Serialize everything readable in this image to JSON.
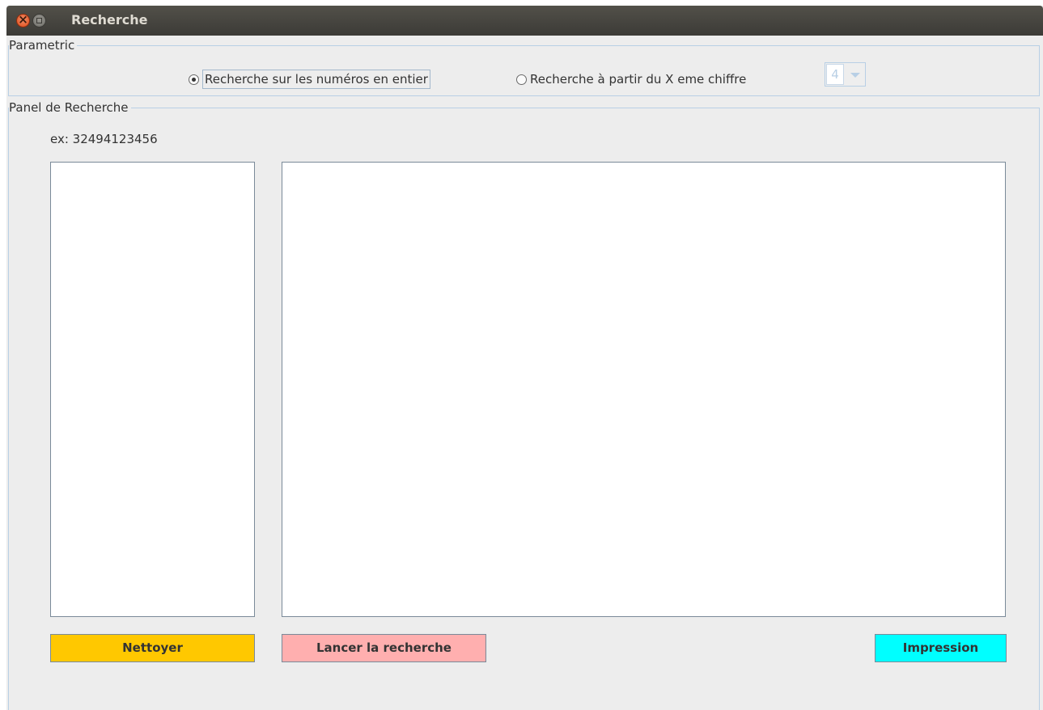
{
  "window": {
    "title": "Recherche"
  },
  "parametric": {
    "legend": "Parametric",
    "options": [
      {
        "label": "Recherche sur les numéros en entier",
        "checked": true
      },
      {
        "label": "Recherche à partir du X eme chiffre",
        "checked": false
      }
    ],
    "digit_select": {
      "value": "4",
      "enabled": false
    }
  },
  "search_panel": {
    "legend": "Panel de Recherche",
    "example": "ex: 32494123456",
    "input_text": "",
    "results_text": ""
  },
  "buttons": {
    "clear": {
      "label": "Nettoyer",
      "color": "#ffc800"
    },
    "search": {
      "label": "Lancer la recherche",
      "color": "#ffafaf"
    },
    "print": {
      "label": "Impression",
      "color": "#00ffff"
    }
  }
}
